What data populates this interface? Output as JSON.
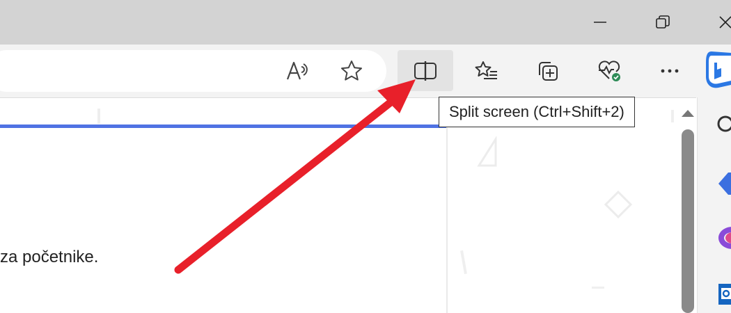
{
  "window_controls": {
    "minimize_icon": "minimize-icon",
    "restore_icon": "restore-icon",
    "close_icon": "close-icon"
  },
  "address_bar": {
    "read_aloud_icon": "read-aloud-icon",
    "favorite_icon": "star-icon"
  },
  "toolbar": {
    "split_screen_icon": "split-screen-icon",
    "favorites_icon": "favorites-list-icon",
    "collections_icon": "collections-icon",
    "browser_essentials_icon": "heart-pulse-icon",
    "more_icon": "more-dots-icon",
    "copilot_icon": "copilot-icon"
  },
  "tooltip": {
    "text": "Split screen (Ctrl+Shift+2)"
  },
  "page": {
    "text": "za početnike."
  },
  "annotation": {
    "arrow_color": "#e8202a"
  },
  "colors": {
    "progress_bar": "#4f72e3"
  }
}
